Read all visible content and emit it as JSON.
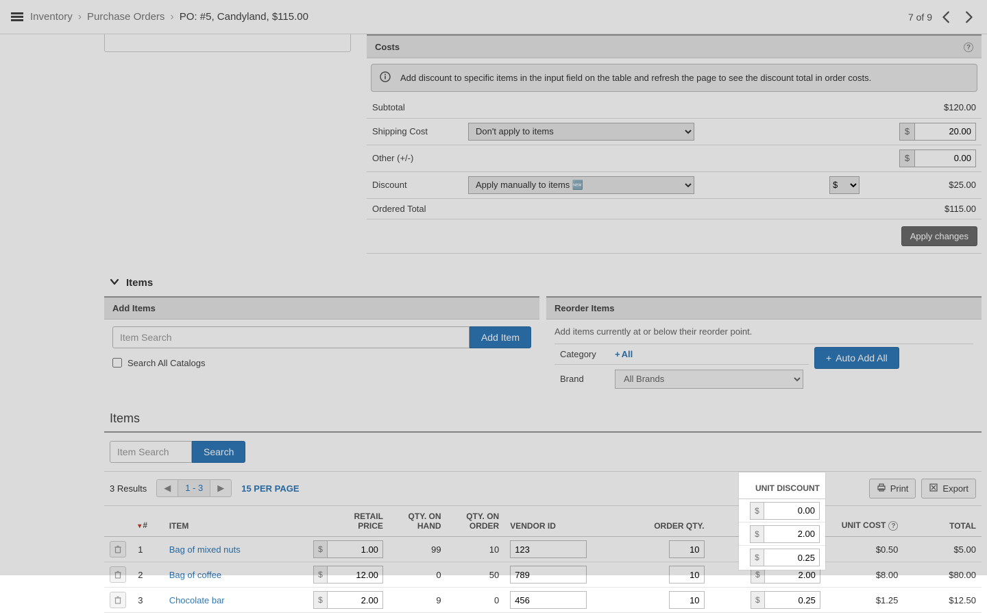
{
  "header": {
    "breadcrumbs": {
      "inventory": "Inventory",
      "purchase_orders": "Purchase Orders",
      "current": "PO:  #5, Candyland, $115.00"
    },
    "pager_text": "7 of 9"
  },
  "costs": {
    "title": "Costs",
    "info_text": "Add discount to specific items in the input field on the table and refresh the page to see the discount total in order costs.",
    "rows": {
      "subtotal_label": "Subtotal",
      "subtotal_value": "$120.00",
      "shipping_label": "Shipping Cost",
      "shipping_select": "Don't apply to items",
      "shipping_prefix": "$",
      "shipping_value": "20.00",
      "other_label": "Other (+/-)",
      "other_prefix": "$",
      "other_value": "0.00",
      "discount_label": "Discount",
      "discount_select": "Apply manually to items 🆕",
      "discount_unit": "$",
      "discount_value": "$25.00",
      "ordered_total_label": "Ordered Total",
      "ordered_total_value": "$115.00"
    },
    "apply_button": "Apply changes"
  },
  "items_section": {
    "accordion_label": "Items",
    "add_items": {
      "title": "Add Items",
      "search_placeholder": "Item Search",
      "add_button": "Add Item",
      "search_all_label": "Search All Catalogs"
    },
    "reorder": {
      "title": "Reorder Items",
      "hint": "Add items currently at or below their reorder point.",
      "category_label": "Category",
      "category_all": "All",
      "brand_label": "Brand",
      "brand_select": "All Brands",
      "auto_add_button": "Auto Add All"
    }
  },
  "items_list": {
    "title": "Items",
    "search_placeholder": "Item Search",
    "search_button": "Search",
    "results_text": "3 Results",
    "page_range": "1 - 3",
    "per_page": "15 PER PAGE",
    "print_label": "Print",
    "export_label": "Export",
    "columns": {
      "num": "#",
      "item": "ITEM",
      "retail_price_l1": "RETAIL",
      "retail_price_l2": "PRICE",
      "qty_on_hand_l1": "QTY. ON",
      "qty_on_hand_l2": "HAND",
      "qty_on_order_l1": "QTY. ON",
      "qty_on_order_l2": "ORDER",
      "vendor_id": "VENDOR ID",
      "order_qty": "ORDER QTY.",
      "unit_discount": "UNIT DISCOUNT",
      "unit_cost": "UNIT COST",
      "total": "TOTAL"
    },
    "rows": [
      {
        "num": "1",
        "item": "Bag of mixed nuts",
        "retail": "1.00",
        "on_hand": "99",
        "on_order": "10",
        "vendor": "123",
        "order_qty": "10",
        "discount": "0.00",
        "unit_cost": "$0.50",
        "total": "$5.00"
      },
      {
        "num": "2",
        "item": "Bag of coffee",
        "retail": "12.00",
        "on_hand": "0",
        "on_order": "50",
        "vendor": "789",
        "order_qty": "10",
        "discount": "2.00",
        "unit_cost": "$8.00",
        "total": "$80.00"
      },
      {
        "num": "3",
        "item": "Chocolate bar",
        "retail": "2.00",
        "on_hand": "9",
        "on_order": "0",
        "vendor": "456",
        "order_qty": "10",
        "discount": "0.25",
        "unit_cost": "$1.25",
        "total": "$12.50"
      }
    ]
  }
}
